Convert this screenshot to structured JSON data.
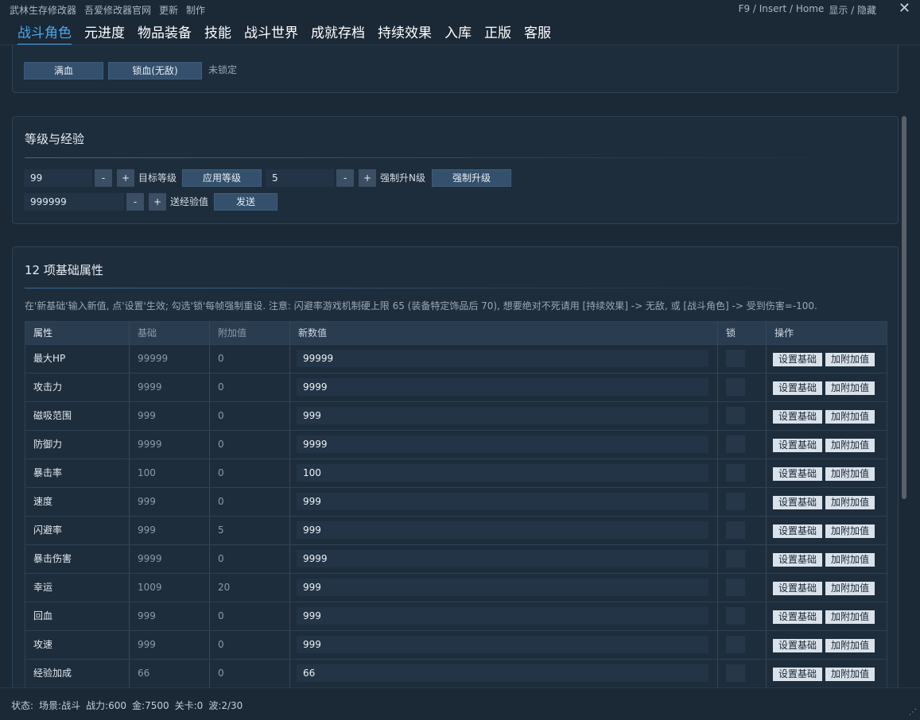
{
  "topbar": {
    "links": [
      "武林生存修改器",
      "吾爱修改器官网",
      "更新",
      "制作"
    ],
    "hotkeys": "F9 / Insert / Home",
    "toggle": "显示 / 隐藏",
    "close": "✕"
  },
  "nav": {
    "tabs": [
      "战斗角色",
      "元进度",
      "物品装备",
      "技能",
      "战斗世界",
      "成就存档",
      "持续效果",
      "入库",
      "正版",
      "客服"
    ]
  },
  "hp_panel": {
    "full_hp": "满血",
    "lock_hp": "锁血(无敌)",
    "lock_status": "未锁定"
  },
  "level_panel": {
    "title": "等级与经验",
    "target_level_value": "99",
    "minus": "-",
    "plus": "+",
    "target_level_label": "目标等级",
    "apply_level": "应用等级",
    "force_n_value": "5",
    "force_n_label": "强制升N级",
    "force_level": "强制升级",
    "exp_value": "999999",
    "exp_label": "送经验值",
    "send": "发送"
  },
  "attr_panel": {
    "title": "12 项基础属性",
    "note": "在'新基础'输入新值, 点'设置'生效; 勾选'锁'每帧强制重设. 注意: 闪避率游戏机制硬上限 65 (装备特定饰品后 70), 想要绝对不死请用 [持续效果] -> 无敌, 或 [战斗角色] -> 受到伤害=-100.",
    "headers": [
      "属性",
      "基础",
      "附加值",
      "新数值",
      "锁",
      "操作"
    ],
    "set_base": "设置基础",
    "add_bonus": "加附加值",
    "rows": [
      {
        "name": "最大HP",
        "base": "99999",
        "bonus": "0",
        "new": "99999"
      },
      {
        "name": "攻击力",
        "base": "9999",
        "bonus": "0",
        "new": "9999"
      },
      {
        "name": "磁吸范围",
        "base": "999",
        "bonus": "0",
        "new": "999"
      },
      {
        "name": "防御力",
        "base": "9999",
        "bonus": "0",
        "new": "9999"
      },
      {
        "name": "暴击率",
        "base": "100",
        "bonus": "0",
        "new": "100"
      },
      {
        "name": "速度",
        "base": "999",
        "bonus": "0",
        "new": "999"
      },
      {
        "name": "闪避率",
        "base": "999",
        "bonus": "5",
        "new": "999"
      },
      {
        "name": "暴击伤害",
        "base": "9999",
        "bonus": "0",
        "new": "9999"
      },
      {
        "name": "幸运",
        "base": "1009",
        "bonus": "20",
        "new": "999"
      },
      {
        "name": "回血",
        "base": "999",
        "bonus": "0",
        "new": "999"
      },
      {
        "name": "攻速",
        "base": "999",
        "bonus": "0",
        "new": "999"
      },
      {
        "name": "经验加成",
        "base": "66",
        "bonus": "0",
        "new": "66"
      }
    ]
  },
  "status": {
    "label": "状态:",
    "scene": "场景:战斗",
    "power": "战力:600",
    "gold": "金:7500",
    "stage": "关卡:0",
    "wave": "波:2/30"
  }
}
